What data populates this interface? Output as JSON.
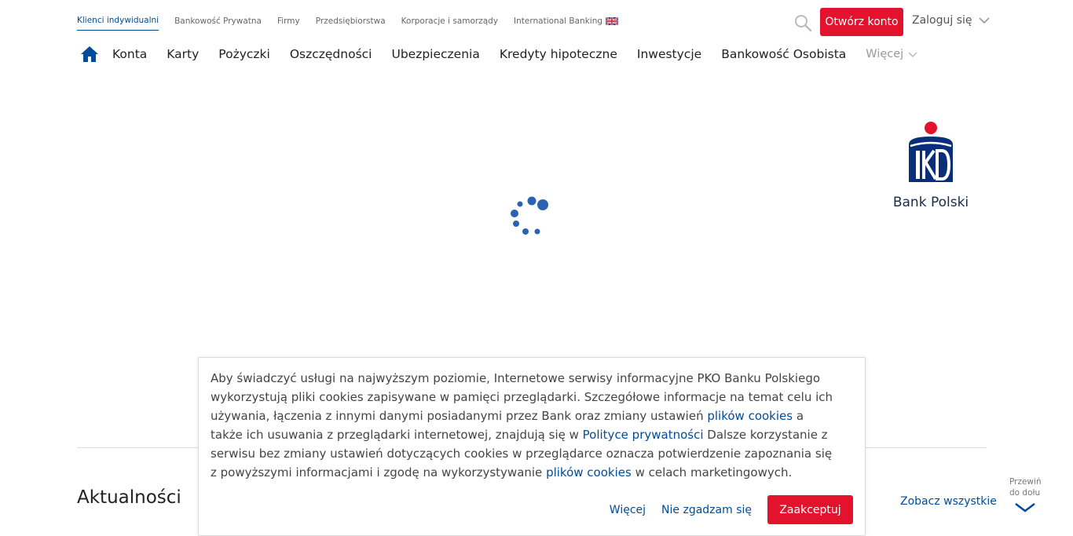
{
  "segments": [
    {
      "label": "Klienci indywidualni",
      "active": true
    },
    {
      "label": "Bankowość Prywatna"
    },
    {
      "label": "Firmy"
    },
    {
      "label": "Przedsiębiorstwa"
    },
    {
      "label": "Korporacje i samorządy"
    },
    {
      "label": "International Banking",
      "icon": "uk-flag-icon"
    }
  ],
  "header": {
    "open_account": "Otwórz konto",
    "login": "Zaloguj się",
    "search_icon": "search-icon",
    "accent_color": "#e3122d",
    "link_color": "#004c9a"
  },
  "main_nav": {
    "home_icon": "home-icon",
    "items": [
      "Konta",
      "Karty",
      "Pożyczki",
      "Oszczędności",
      "Ubezpieczenia",
      "Kredyty hipoteczne",
      "Inwestycje",
      "Bankowość Osobista"
    ],
    "more": "Więcej"
  },
  "logo": {
    "text": "Bank Polski"
  },
  "news": {
    "title": "Aktualności",
    "see_all": "Zobacz wszystkie"
  },
  "scroll_hint": {
    "line1": "Przewiń",
    "line2": "do dołu"
  },
  "cookie": {
    "p1": "Aby świadczyć usługi na najwyższym poziomie, Internetowe serwisy informacyjne PKO Banku Polskiego wykorzystują pliki cookies zapisywane w pamięci przeglądarki. Szczegółowe informacje na temat celu ich używania, łączenia z innymi danymi posiadanymi przez Bank oraz zmiany ustawień ",
    "link1": "plików cookies",
    "p2": " a także ich usuwania z przeglądarki internetowej, znajdują się w ",
    "link2": "Polityce prywatności",
    "p3": " Dalsze korzystanie z serwisu bez zmiany ustawień dotyczących cookies w przeglądarce oznacza potwierdzenie zapoznania się z powyższymi informacjami i zgodę na wykorzystywanie ",
    "link3": "plików cookies",
    "p4": " w celach marketingowych.",
    "more": "Więcej",
    "decline": "Nie zgadzam się",
    "accept": "Zaakceptuj"
  }
}
